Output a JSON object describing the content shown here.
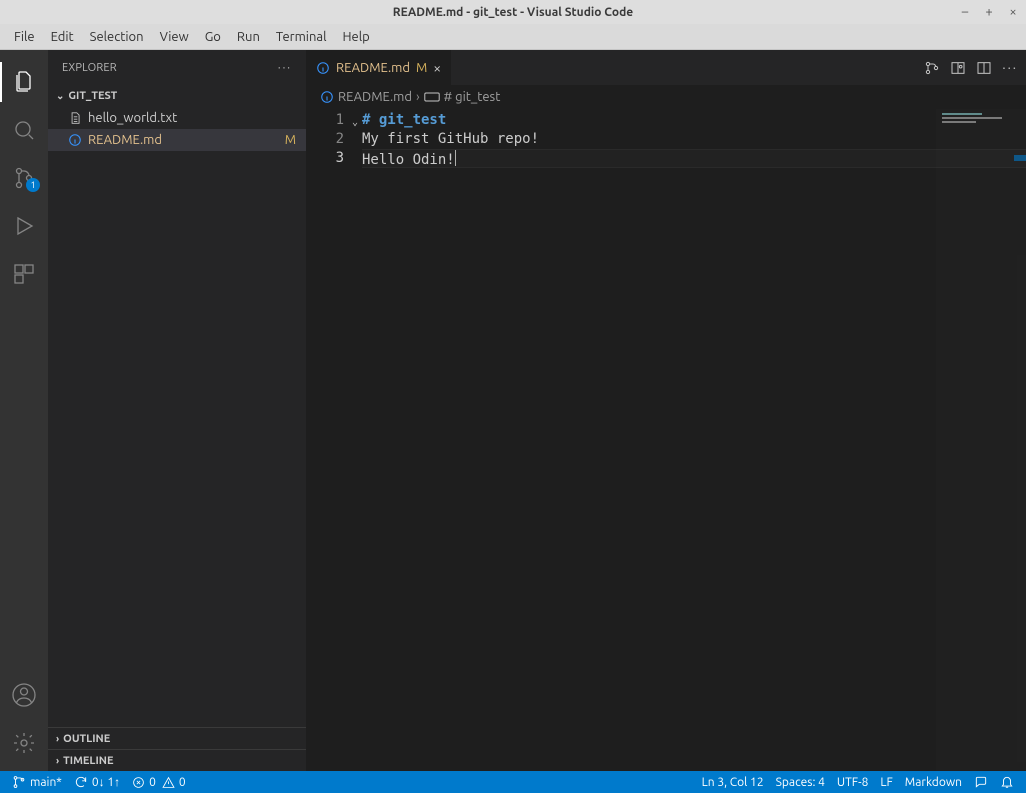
{
  "os_title": "README.md - git_test - Visual Studio Code",
  "menubar": [
    "File",
    "Edit",
    "Selection",
    "View",
    "Go",
    "Run",
    "Terminal",
    "Help"
  ],
  "activitybar": {
    "scm_badge": "1"
  },
  "sidebar": {
    "title": "EXPLORER",
    "root": "GIT_TEST",
    "files": [
      {
        "name": "hello_world.txt",
        "icon": "file-text",
        "status": "",
        "active": false
      },
      {
        "name": "README.md",
        "icon": "info-circle",
        "status": "M",
        "active": true
      }
    ],
    "outline": "OUTLINE",
    "timeline": "TIMELINE"
  },
  "tab": {
    "title": "README.md",
    "status": "M"
  },
  "breadcrumb": {
    "file": "README.md",
    "symbol": "# git_test"
  },
  "editor": {
    "lines": [
      {
        "n": "1",
        "kind": "heading",
        "text": "# git_test"
      },
      {
        "n": "2",
        "kind": "plain",
        "text": "My first GitHub repo!"
      },
      {
        "n": "3",
        "kind": "plain",
        "text": "Hello Odin!"
      }
    ],
    "current_line_index": 2
  },
  "statusbar": {
    "branch": "main*",
    "sync": "0↓ 1↑",
    "errors": "0",
    "warnings": "0",
    "position": "Ln 3, Col 12",
    "spaces": "Spaces: 4",
    "encoding": "UTF-8",
    "eol": "LF",
    "language": "Markdown"
  }
}
